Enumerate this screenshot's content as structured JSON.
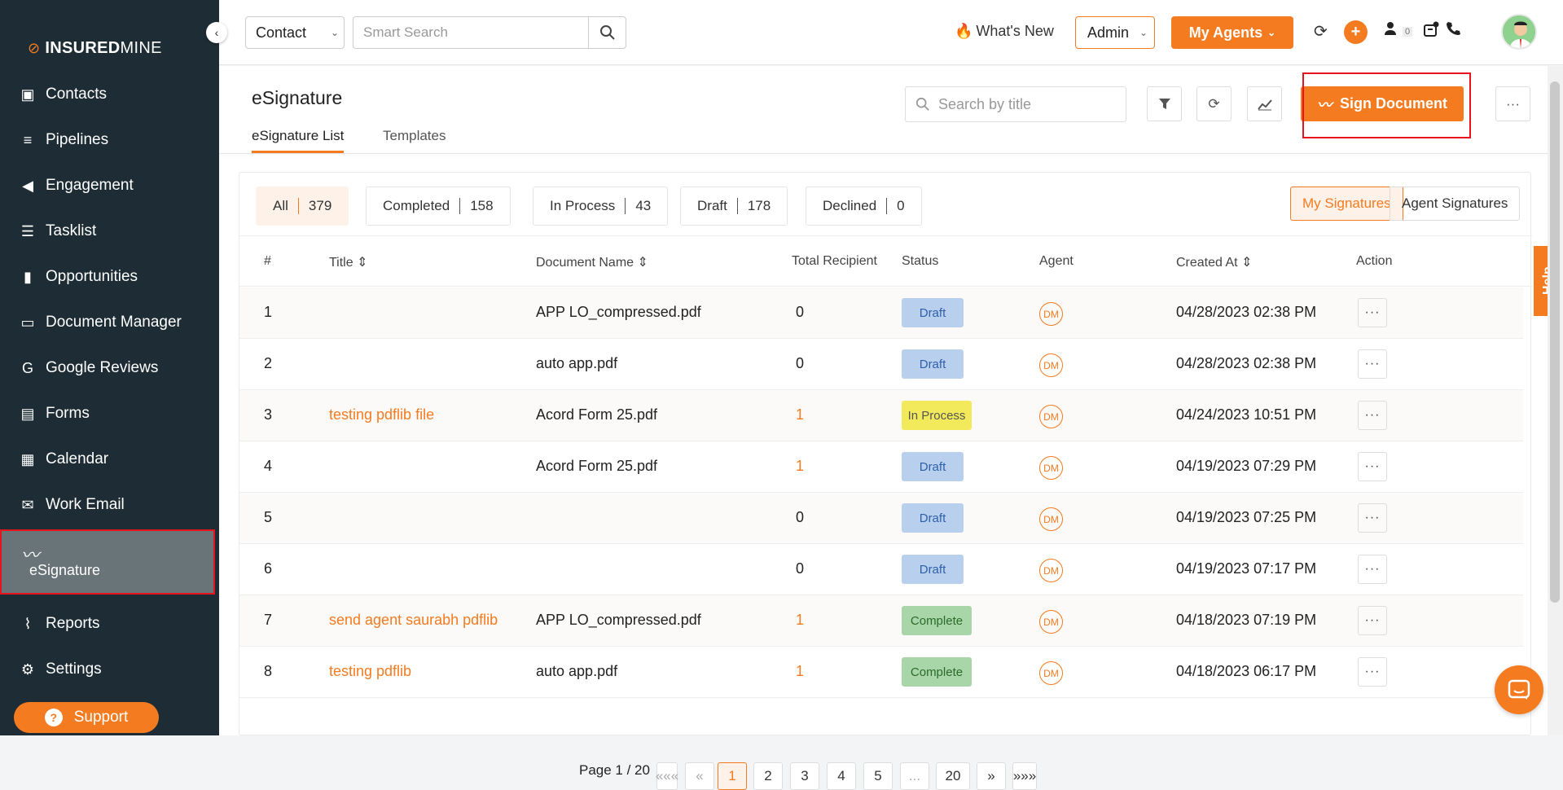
{
  "app": {
    "brand_light": "INSURED",
    "brand_bold_part": "MINE"
  },
  "sidebar": {
    "items": [
      {
        "label": "Contacts",
        "icon": "contacts-icon"
      },
      {
        "label": "Pipelines",
        "icon": "pipelines-icon"
      },
      {
        "label": "Engagement",
        "icon": "megaphone-icon"
      },
      {
        "label": "Tasklist",
        "icon": "tasklist-icon"
      },
      {
        "label": "Opportunities",
        "icon": "opportunities-icon"
      },
      {
        "label": "Document Manager",
        "icon": "folder-icon"
      },
      {
        "label": "Google Reviews",
        "icon": "google-icon"
      },
      {
        "label": "Forms",
        "icon": "forms-icon"
      },
      {
        "label": "Calendar",
        "icon": "calendar-icon"
      },
      {
        "label": "Work Email",
        "icon": "email-icon"
      },
      {
        "label": "eSignature",
        "icon": "signature-icon",
        "active": true
      },
      {
        "label": "Reports",
        "icon": "reports-icon"
      },
      {
        "label": "Settings",
        "icon": "gear-icon"
      }
    ],
    "support_label": "Support"
  },
  "topbar": {
    "contact_select": "Contact",
    "smart_search_placeholder": "Smart Search",
    "whats_new": "What's New",
    "role_select": "Admin",
    "my_agents": "My Agents",
    "notification_count": "0"
  },
  "page": {
    "title": "eSignature",
    "tabs": [
      "eSignature List",
      "Templates"
    ],
    "search_placeholder": "Search by title",
    "sign_document": "Sign Document",
    "filters": [
      {
        "label": "All",
        "count": "379"
      },
      {
        "label": "Completed",
        "count": "158"
      },
      {
        "label": "In Process",
        "count": "43"
      },
      {
        "label": "Draft",
        "count": "178"
      },
      {
        "label": "Declined",
        "count": "0"
      }
    ],
    "toggle": {
      "mine": "My Signatures",
      "agents": "Agent Signatures"
    },
    "columns": [
      "#",
      "Title",
      "Document Name",
      "Total Recipient",
      "Status",
      "Agent",
      "Created At",
      "Action"
    ],
    "rows": [
      {
        "n": "1",
        "title": "",
        "doc": "APP LO_compressed.pdf",
        "recipients": "0",
        "status": "Draft",
        "agent": "DM",
        "created": "04/28/2023 02:38 PM"
      },
      {
        "n": "2",
        "title": "",
        "doc": "auto app.pdf",
        "recipients": "0",
        "status": "Draft",
        "agent": "DM",
        "created": "04/28/2023 02:38 PM"
      },
      {
        "n": "3",
        "title": "testing pdflib file",
        "doc": "Acord Form 25.pdf",
        "recipients": "1",
        "status": "In Process",
        "agent": "DM",
        "created": "04/24/2023 10:51 PM"
      },
      {
        "n": "4",
        "title": "",
        "doc": "Acord Form 25.pdf",
        "recipients": "1",
        "status": "Draft",
        "agent": "DM",
        "created": "04/19/2023 07:29 PM"
      },
      {
        "n": "5",
        "title": "",
        "doc": "",
        "recipients": "0",
        "status": "Draft",
        "agent": "DM",
        "created": "04/19/2023 07:25 PM"
      },
      {
        "n": "6",
        "title": "",
        "doc": "",
        "recipients": "0",
        "status": "Draft",
        "agent": "DM",
        "created": "04/19/2023 07:17 PM"
      },
      {
        "n": "7",
        "title": "send agent saurabh pdflib",
        "doc": "APP LO_compressed.pdf",
        "recipients": "1",
        "status": "Complete",
        "agent": "DM",
        "created": "04/18/2023 07:19 PM"
      },
      {
        "n": "8",
        "title": "testing pdflib",
        "doc": "auto app.pdf",
        "recipients": "1",
        "status": "Complete",
        "agent": "DM",
        "created": "04/18/2023 06:17 PM"
      }
    ],
    "pagination": {
      "label": "Page 1 / 20",
      "first": "«««",
      "prev": "«",
      "pages": [
        "1",
        "2",
        "3",
        "4",
        "5",
        "...",
        "20"
      ],
      "next": "»",
      "last": "»»»",
      "current": "1"
    },
    "help_label": "Help"
  },
  "colors": {
    "accent": "#f47b20",
    "sidebar_bg": "#1e2d35",
    "highlight": "#e8121c"
  }
}
